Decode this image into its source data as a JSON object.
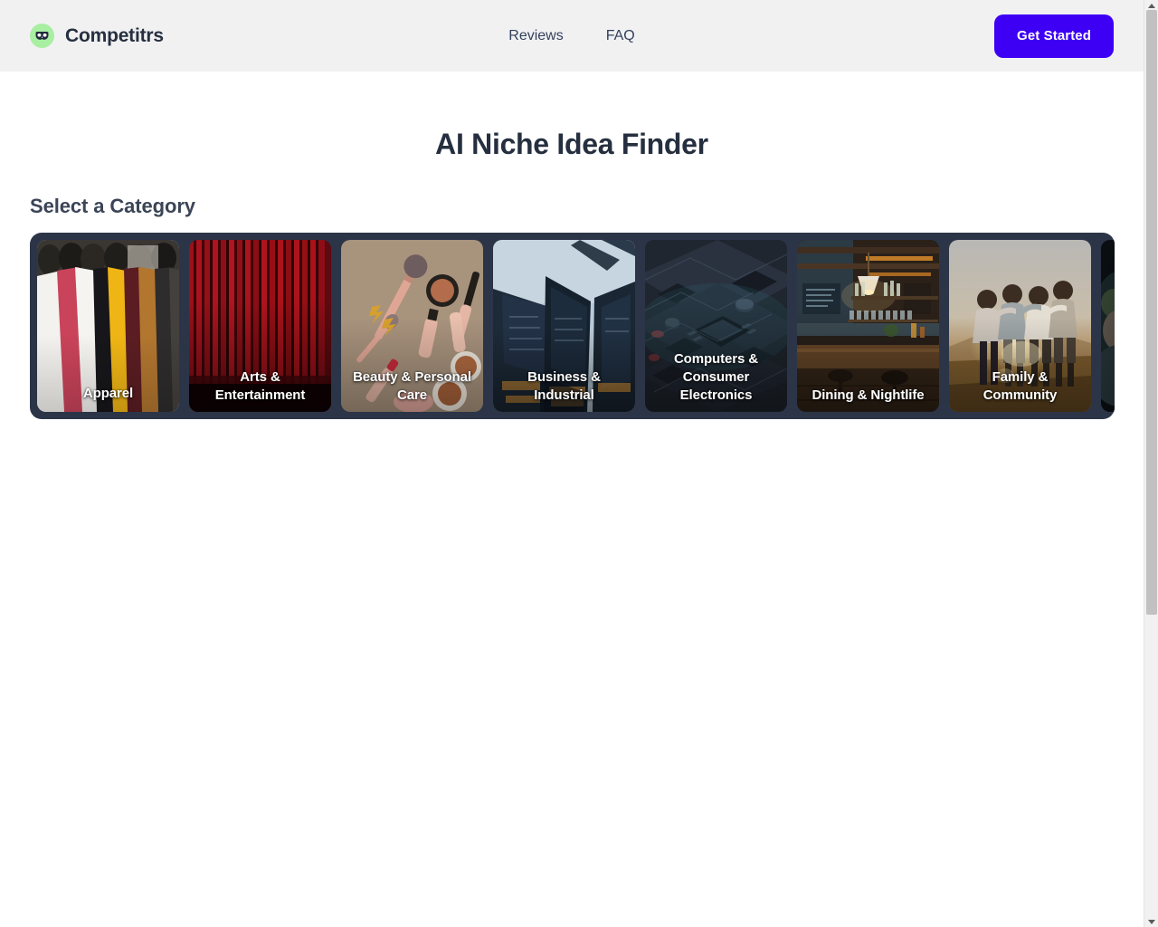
{
  "header": {
    "brand_name": "Competitrs",
    "logo_icon": "mask-logo-icon",
    "logo_bg_color": "#a8efa2",
    "nav": [
      {
        "label": "Reviews",
        "name": "nav-link-reviews"
      },
      {
        "label": "FAQ",
        "name": "nav-link-faq"
      }
    ],
    "cta_label": "Get Started",
    "cta_color": "#3d00f5",
    "background_color": "#f1f1f2"
  },
  "main": {
    "page_title": "AI Niche Idea Finder",
    "section_heading": "Select a Category",
    "carousel": {
      "background_color": "#2c3547",
      "cards": [
        {
          "label": "Apparel",
          "art": "clothing-rack",
          "name": "category-card-apparel"
        },
        {
          "label": "Arts & Entertainment",
          "art": "red-curtain",
          "name": "category-card-arts-entertainment"
        },
        {
          "label": "Beauty & Personal Care",
          "art": "makeup-flatlay",
          "name": "category-card-beauty-personal-care"
        },
        {
          "label": "Business & Industrial",
          "art": "skyscrapers",
          "name": "category-card-business-industrial"
        },
        {
          "label": "Computers & Consumer Electronics",
          "art": "circuit-board",
          "name": "category-card-computers-consumer-electronics"
        },
        {
          "label": "Dining & Nightlife",
          "art": "bar-interior",
          "name": "category-card-dining-nightlife"
        },
        {
          "label": "Family & Community",
          "art": "friends-sunset",
          "name": "category-card-family-community"
        },
        {
          "label": "",
          "art": "next-card-peek",
          "name": "category-card-next-peek"
        }
      ]
    }
  },
  "scrollbar": {
    "up_arrow": "chevron-up-icon",
    "down_arrow": "chevron-down-icon",
    "thumb": "scrollbar-thumb"
  }
}
